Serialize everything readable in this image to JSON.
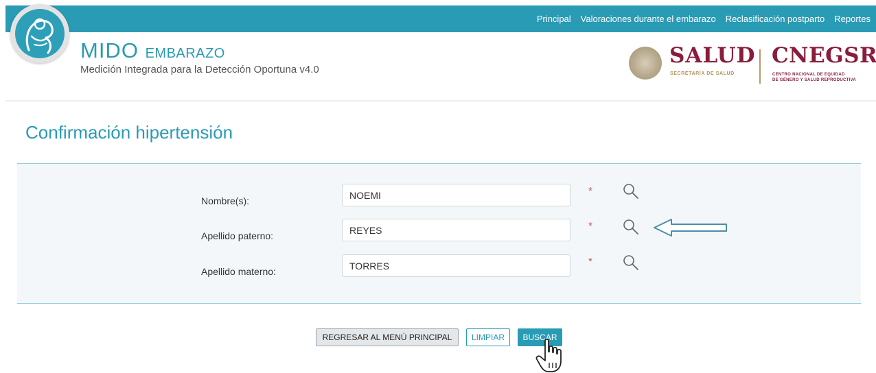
{
  "nav": {
    "items": [
      "Principal",
      "Valoraciones durante el embarazo",
      "Reclasificación postparto",
      "Reportes"
    ]
  },
  "header": {
    "app_name_main": "MIDO",
    "app_name_small": "EMBARAZO",
    "subtitle": "Medición Integrada para la Detección Oportuna v4.0",
    "logo_salud": "SALUD",
    "logo_salud_sub": "SECRETARÍA DE SALUD",
    "logo_cnegsr": "CNEGSR",
    "logo_cnegsr_sub_1": "CENTRO NACIONAL DE EQUIDAD",
    "logo_cnegsr_sub_2": "DE GÉNERO Y SALUD REPRODUCTIVA"
  },
  "page": {
    "title": "Confirmación hipertensión"
  },
  "form": {
    "fields": [
      {
        "label": "Nombre(s):",
        "value": "NOEMI",
        "required_mark": "*"
      },
      {
        "label": "Apellido paterno:",
        "value": "REYES",
        "required_mark": "*"
      },
      {
        "label": "Apellido materno:",
        "value": "TORRES",
        "required_mark": "*"
      }
    ]
  },
  "buttons": {
    "back": "REGRESAR AL MENÚ PRINCIPAL",
    "clear": "LIMPIAR",
    "search": "BUSCAR"
  },
  "colors": {
    "accent": "#2a9bb5",
    "brand_maroon": "#8a1c3c",
    "required": "#d9534f"
  },
  "icons": {
    "logo": "pregnancy-logo-icon",
    "search": "magnifier-icon",
    "pointer": "hand-cursor-icon",
    "annotation": "left-arrow-icon"
  }
}
